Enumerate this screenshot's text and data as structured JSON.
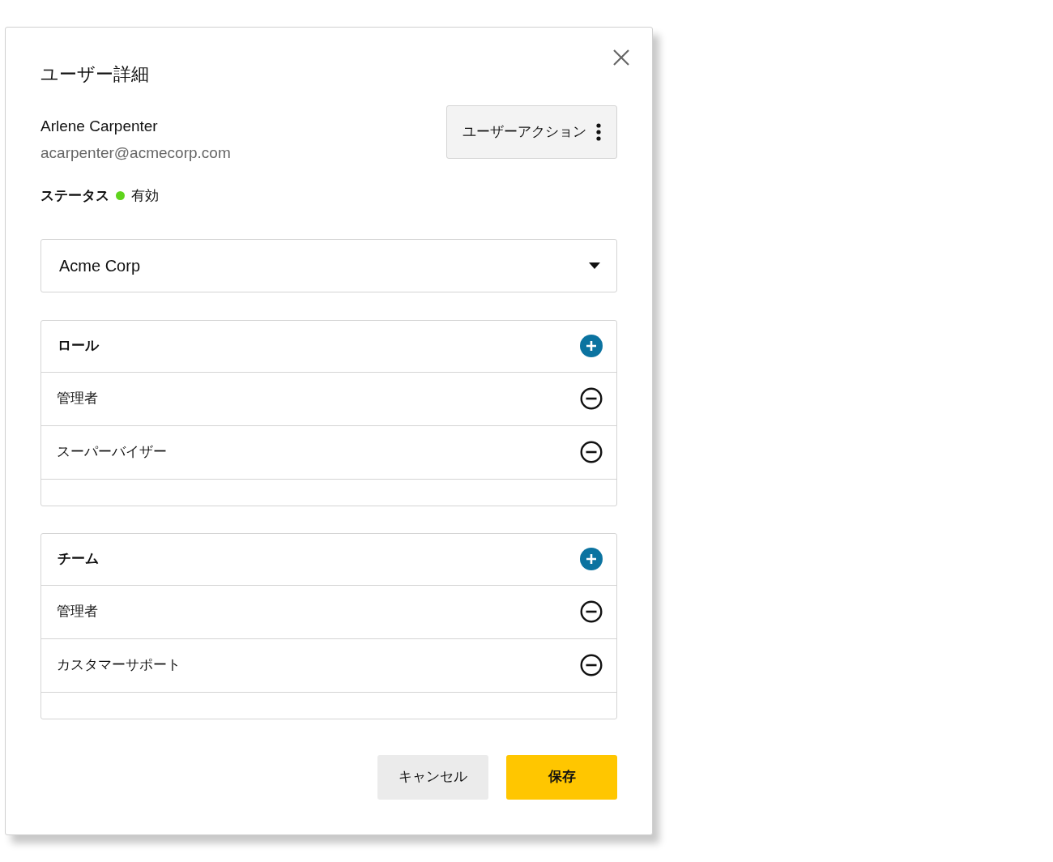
{
  "dialog": {
    "title": "ユーザー詳細"
  },
  "user": {
    "name": "Arlene Carpenter",
    "email": "acarpenter@acmecorp.com"
  },
  "actions_button": {
    "label": "ユーザーアクション"
  },
  "status": {
    "label": "ステータス",
    "value": "有効",
    "color": "#5fd41c"
  },
  "organization_select": {
    "value": "Acme Corp"
  },
  "sections": [
    {
      "title": "ロール",
      "items": [
        "管理者",
        "スーパーバイザー"
      ]
    },
    {
      "title": "チーム",
      "items": [
        "管理者",
        "カスタマーサポート"
      ]
    }
  ],
  "buttons": [
    {
      "label": "キャンセル",
      "kind": "secondary"
    },
    {
      "label": "保存",
      "kind": "primary"
    }
  ]
}
